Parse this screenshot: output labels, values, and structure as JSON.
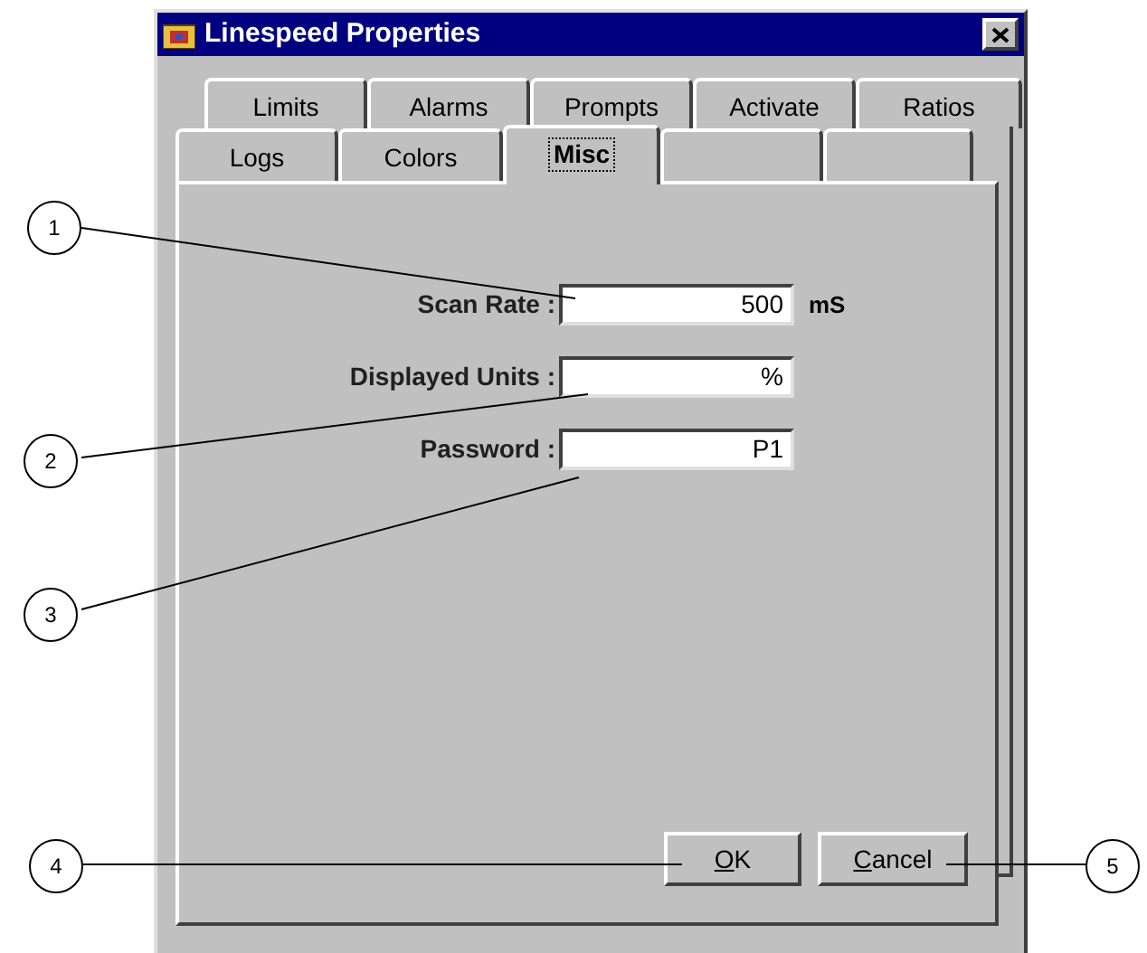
{
  "window": {
    "title": "Linespeed Properties"
  },
  "tab_rows": [
    [
      {
        "label": "Limits",
        "selected": false
      },
      {
        "label": "Alarms",
        "selected": false
      },
      {
        "label": "Prompts",
        "selected": false
      },
      {
        "label": "Activate",
        "selected": false
      },
      {
        "label": "Ratios",
        "selected": false
      }
    ],
    [
      {
        "label": "Logs",
        "selected": false
      },
      {
        "label": "Colors",
        "selected": false
      },
      {
        "label": "Misc",
        "selected": true
      },
      {
        "selected": false
      },
      {
        "selected": false
      }
    ]
  ],
  "fields": [
    {
      "label": "Scan Rate :",
      "value": "500",
      "unit": "mS"
    },
    {
      "label": "Displayed Units :",
      "value": "%"
    },
    {
      "label": "Password :",
      "value": "P1"
    }
  ],
  "buttons": [
    {
      "label": "OK"
    },
    {
      "label": "Cancel"
    }
  ],
  "callouts": [
    "1",
    "2",
    "3",
    "4",
    "5"
  ]
}
